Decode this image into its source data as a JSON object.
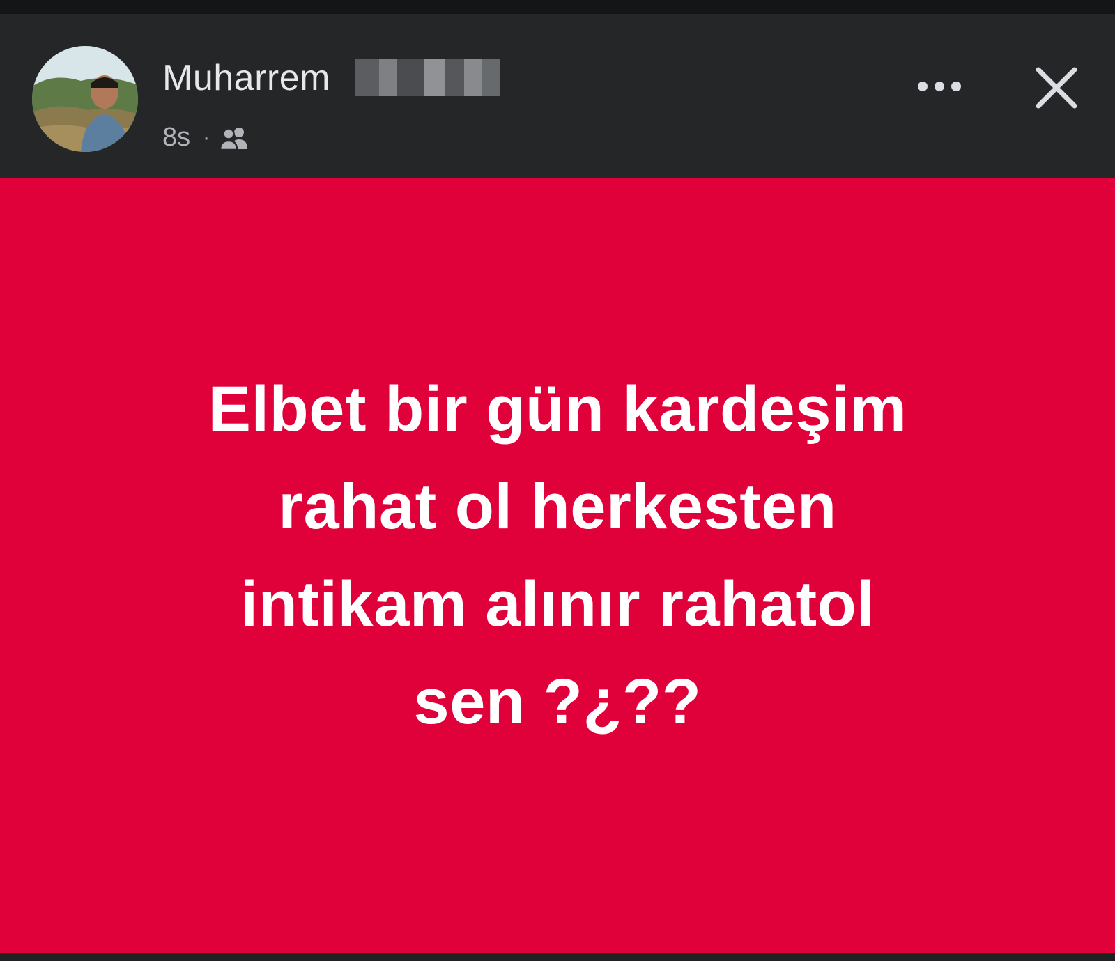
{
  "post": {
    "author": "Muharrem",
    "timestamp": "8s",
    "separator": "·",
    "audience_icon": "friends-icon",
    "text_lines": [
      "Elbet bir gün kardeşim",
      "rahat ol herkesten",
      "intikam alınır rahatol",
      "sen ?¿??"
    ],
    "background_color": "#e0003a",
    "text_color": "#ffffff"
  },
  "header": {
    "more_icon": "more-options-icon",
    "close_icon": "close-icon",
    "background_color": "#242628"
  }
}
